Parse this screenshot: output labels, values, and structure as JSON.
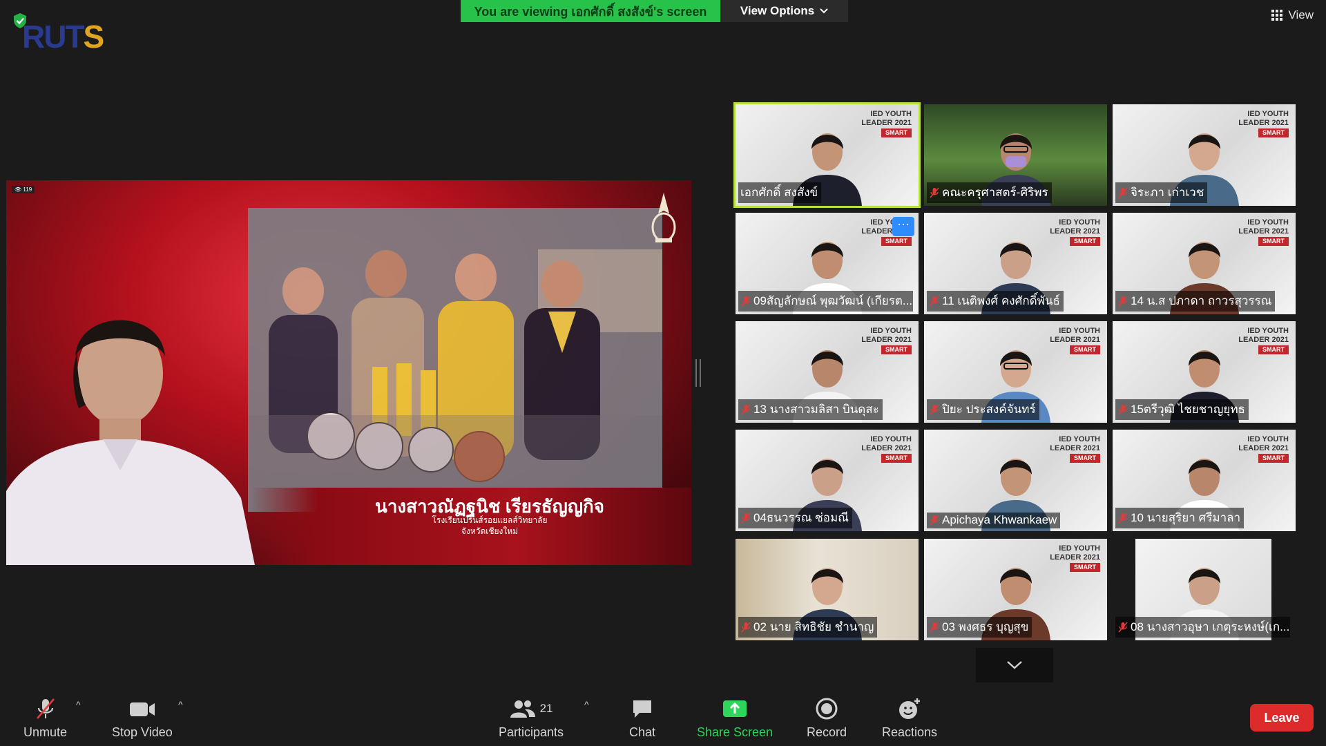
{
  "banner": {
    "text": "You are viewing เอกศักดิ์ สงสังข์'s screen"
  },
  "view_options": {
    "label": "View Options"
  },
  "top_right": {
    "view_label": "View"
  },
  "logo": {
    "text_a": "RUT",
    "text_b": "S"
  },
  "share_screen": {
    "live_count": "119",
    "presenter_name": "นางสาวณัฏฐนิช  เรียรธัญญกิจ",
    "presenter_school": "โรงเรียนปรินส์รอยแยลส์วิทยาลัย",
    "presenter_province": "จังหวัดเชียงใหม่"
  },
  "tile_brand": {
    "line1": "IED YOUTH",
    "line2": "LEADER 2021",
    "smart": "SMART"
  },
  "participants_tiles": [
    {
      "name": "เอกศักดิ์ สงสังข์",
      "muted": false,
      "active": true
    },
    {
      "name": "คณะครุศาสตร์-ศิริพร",
      "muted": true
    },
    {
      "name": "จิระภา เก่าเวช",
      "muted": true
    },
    {
      "name": "09สัญลักษณ์ พุฒวัฒน์ (เกียรต...",
      "muted": true
    },
    {
      "name": "11 เนติพงศ์ คงศักดิ์พันธ์",
      "muted": true
    },
    {
      "name": "14 น.ส ปภาดา ถาวรสุวรรณ",
      "muted": true
    },
    {
      "name": "13 นางสาวมลิสา บินดุสะ",
      "muted": true
    },
    {
      "name": "ปิยะ ประสงค์จันทร์",
      "muted": true
    },
    {
      "name": "15ตรีวุฒิ ไชยชาญยุทธ",
      "muted": true
    },
    {
      "name": "04ธนวรรณ ซ่อมณี",
      "muted": true
    },
    {
      "name": "Apichaya Khwankaew",
      "muted": true
    },
    {
      "name": "10 นายสุริยา  ศรีมาลา",
      "muted": true
    },
    {
      "name": "02 นาย สิทธิชัย ชำนาญ",
      "muted": true
    },
    {
      "name": "03 พงศธร บุญสุข",
      "muted": true
    },
    {
      "name": "08 นางสาวอุษา เกตุระหงษ์(เก...",
      "muted": true
    }
  ],
  "more_button": {
    "label": "···"
  },
  "toolbar": {
    "unmute": "Unmute",
    "stop_video": "Stop Video",
    "participants": "Participants",
    "participants_count": "21",
    "chat": "Chat",
    "share_screen": "Share Screen",
    "record": "Record",
    "reactions": "Reactions",
    "leave": "Leave"
  },
  "colors": {
    "banner_green": "#27c24a",
    "active_border": "#b6e03c",
    "leave_red": "#dd2b2b",
    "share_green": "#2fd45a"
  }
}
